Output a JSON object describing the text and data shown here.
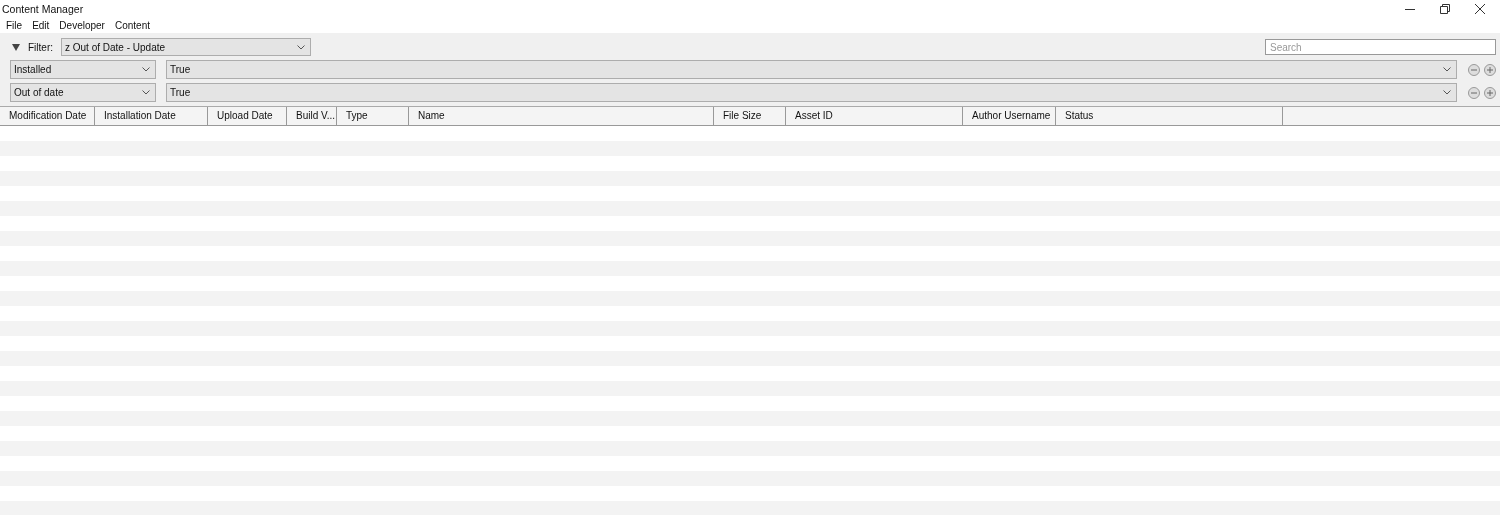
{
  "window": {
    "title": "Content Manager"
  },
  "menu": [
    "File",
    "Edit",
    "Developer",
    "Content"
  ],
  "filter": {
    "label": "Filter:",
    "value": "z Out of Date - Update"
  },
  "search": {
    "placeholder": "Search"
  },
  "rules": [
    {
      "field": "Installed",
      "value": "True"
    },
    {
      "field": "Out of date",
      "value": "True"
    }
  ],
  "table": {
    "columns": [
      "Modification Date",
      "Installation Date",
      "Upload Date",
      "Build V...",
      "Type",
      "Name",
      "File Size",
      "Asset ID",
      "Author Username",
      "Status"
    ]
  }
}
